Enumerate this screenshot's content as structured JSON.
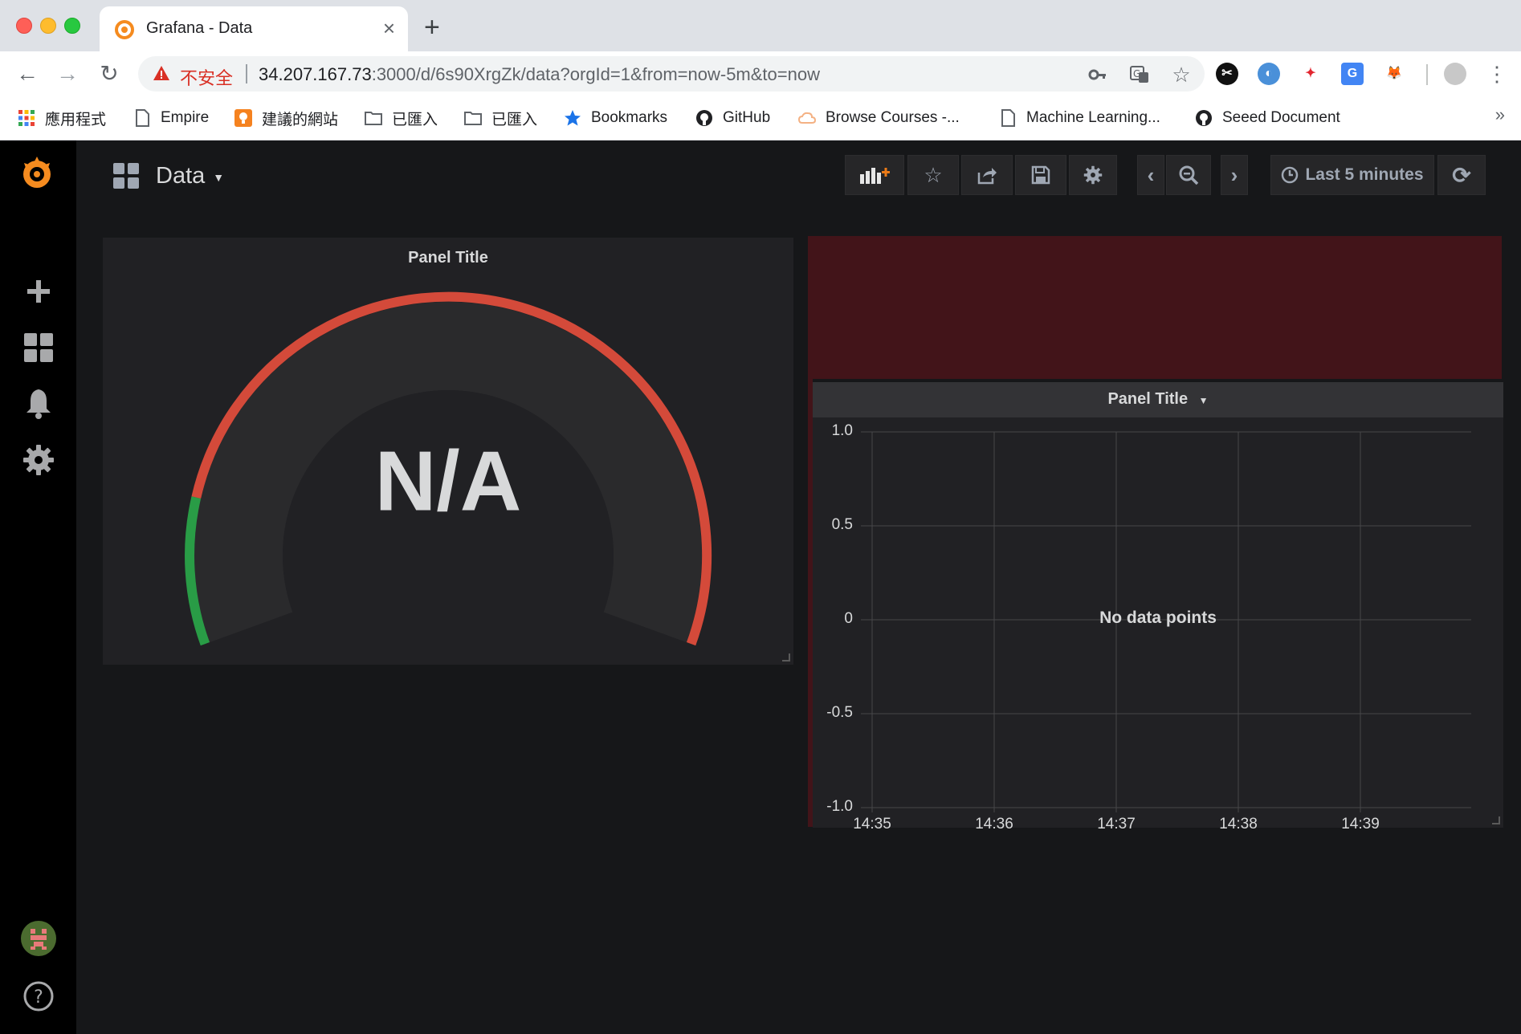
{
  "browser": {
    "tab_title": "Grafana - Data",
    "security_label": "不安全",
    "url_host": "34.207.167.73",
    "url_rest": ":3000/d/6s90XrgZk/data?orgId=1&from=now-5m&to=now",
    "bookmarks": [
      {
        "label": "應用程式",
        "icon": "apps-icon"
      },
      {
        "label": "Empire",
        "icon": "page-icon"
      },
      {
        "label": "建議的網站",
        "icon": "bulb-icon"
      },
      {
        "label": "已匯入",
        "icon": "folder-icon"
      },
      {
        "label": "已匯入",
        "icon": "folder-icon"
      },
      {
        "label": "Bookmarks",
        "icon": "star-icon"
      },
      {
        "label": "GitHub",
        "icon": "github-icon"
      },
      {
        "label": "Browse Courses -...",
        "icon": "cloud-icon"
      },
      {
        "label": "Machine Learning...",
        "icon": "page-icon"
      },
      {
        "label": "Seeed Document",
        "icon": "github-icon"
      }
    ],
    "more_label": "»"
  },
  "grafana": {
    "dashboard_title": "Data",
    "time_range": "Last 5 minutes",
    "colors": {
      "accent": "#eb7b18",
      "threshold_ok": "#299c46",
      "threshold_bad": "#d44a3a"
    },
    "gauge_panel": {
      "title": "Panel Title",
      "value": "N/A",
      "thresholds": {
        "green_fraction": 0.15
      }
    },
    "graph_panel": {
      "title": "Panel Title",
      "no_data": "No data points"
    }
  },
  "chart_data": {
    "type": "line",
    "title": "Panel Title",
    "x": [
      "14:35",
      "14:36",
      "14:37",
      "14:38",
      "14:39"
    ],
    "series": [],
    "ylim": [
      -1.0,
      1.0
    ],
    "yticks": [
      "1.0",
      "0.5",
      "0",
      "-0.5",
      "-1.0"
    ],
    "grid": true,
    "annotation": "No data points"
  }
}
